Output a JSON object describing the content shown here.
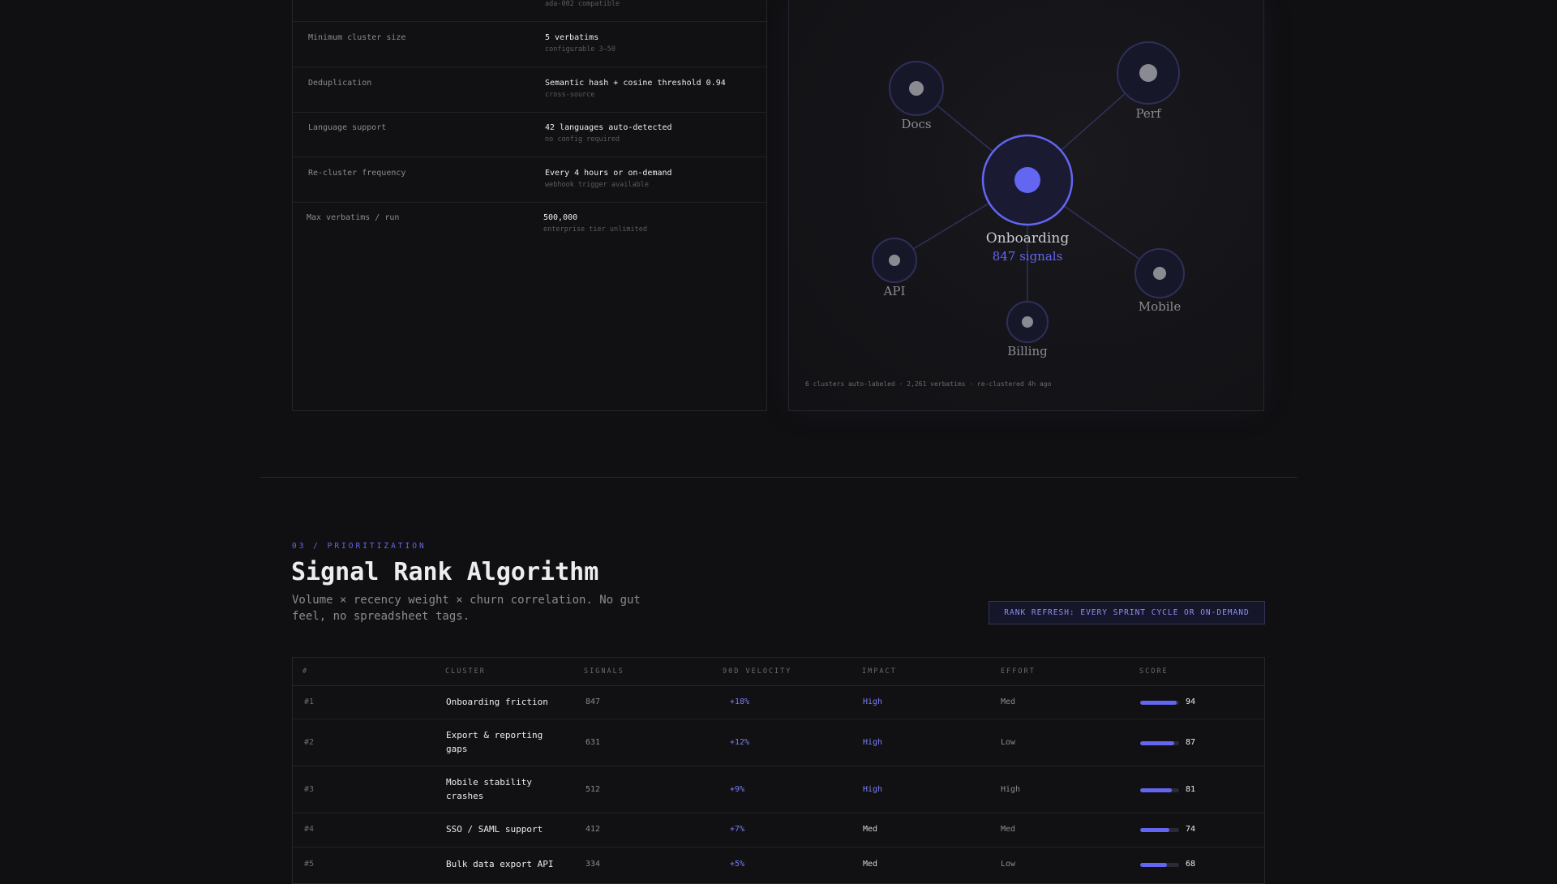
{
  "config_specs": [
    {
      "label": "",
      "value": "",
      "sub": "ada-002 compatible"
    },
    {
      "label": "Minimum cluster size",
      "value": "5 verbatims",
      "sub": "configurable 3–50"
    },
    {
      "label": "Deduplication",
      "value": "Semantic hash + cosine threshold 0.94",
      "sub": "cross-source"
    },
    {
      "label": "Language support",
      "value": "42 languages auto-detected",
      "sub": "no config required"
    },
    {
      "label": "Re-cluster frequency",
      "value": "Every 4 hours or on-demand",
      "sub": "webhook trigger available"
    },
    {
      "label": "Max verbatims / run",
      "value": "500,000",
      "sub": "enterprise tier unlimited"
    }
  ],
  "cluster_graph": {
    "center": {
      "label": "Onboarding",
      "signals": "847 signals"
    },
    "nodes": [
      "Docs",
      "Perf",
      "API",
      "Mobile",
      "Billing"
    ],
    "footer": "6 clusters auto-labeled · 2,261 verbatims · re-clustered 4h ago",
    "accent": "#6366f1"
  },
  "prioritization": {
    "eyebrow": "03 / PRIORITIZATION",
    "title": "Signal Rank Algorithm",
    "subtitle": "Volume × recency weight × churn correlation. No gut feel, no spreadsheet tags.",
    "refresh_badge": "RANK REFRESH: EVERY SPRINT CYCLE OR ON-DEMAND"
  },
  "rank_table": {
    "headers": [
      "#",
      "CLUSTER",
      "SIGNALS",
      "90D VELOCITY",
      "IMPACT",
      "EFFORT",
      "SCORE"
    ],
    "rows": [
      {
        "rank": "#1",
        "cluster": "Onboarding friction",
        "signals": "847",
        "velocity": "+18%",
        "impact": "High",
        "effort": "Med",
        "score": "94",
        "score_fraction": 0.94
      },
      {
        "rank": "#2",
        "cluster": "Export & reporting gaps",
        "signals": "631",
        "velocity": "+12%",
        "impact": "High",
        "effort": "Low",
        "score": "87",
        "score_fraction": 0.87
      },
      {
        "rank": "#3",
        "cluster": "Mobile stability crashes",
        "signals": "512",
        "velocity": "+9%",
        "impact": "High",
        "effort": "High",
        "score": "81",
        "score_fraction": 0.81
      },
      {
        "rank": "#4",
        "cluster": "SSO / SAML support",
        "signals": "412",
        "velocity": "+7%",
        "impact": "Med",
        "effort": "Med",
        "score": "74",
        "score_fraction": 0.74
      },
      {
        "rank": "#5",
        "cluster": "Bulk data export API",
        "signals": "334",
        "velocity": "+5%",
        "impact": "Med",
        "effort": "Low",
        "score": "68",
        "score_fraction": 0.68
      }
    ]
  }
}
